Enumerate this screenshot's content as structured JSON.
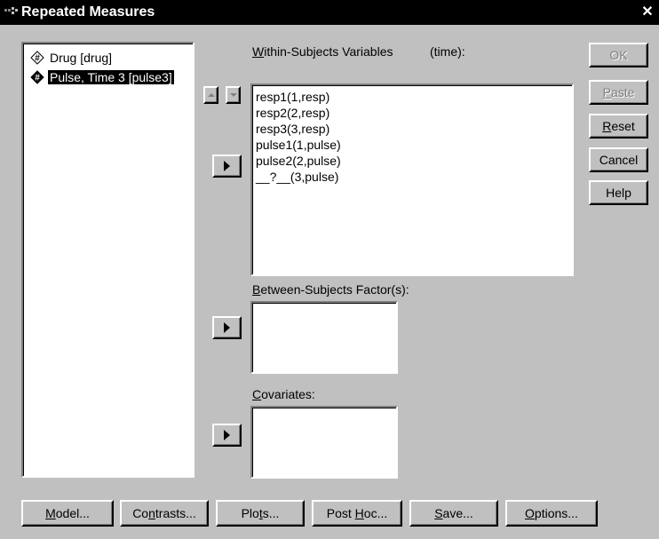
{
  "window": {
    "title": "Repeated Measures"
  },
  "source_list": [
    {
      "label": "Drug [drug]",
      "icon": "nominal-variable-icon",
      "selected": false
    },
    {
      "label": "Pulse, Time 3 [pulse3]",
      "icon": "scale-variable-icon",
      "selected": true
    }
  ],
  "within": {
    "label_mnemonic": "W",
    "label_rest": "ithin-Subjects Variables",
    "factor": "(time):",
    "items": [
      "resp1(1,resp)",
      "resp2(2,resp)",
      "resp3(3,resp)",
      "pulse1(1,pulse)",
      "pulse2(2,pulse)",
      "__?__(3,pulse)"
    ]
  },
  "between": {
    "label_mnemonic": "B",
    "label_rest": "etween-Subjects Factor(s):"
  },
  "covariates": {
    "label_mnemonic": "C",
    "label_rest": "ovariates:"
  },
  "side_buttons": {
    "ok": "OK",
    "paste_m": "P",
    "paste_r": "aste",
    "reset_m": "R",
    "reset_r": "eset",
    "cancel": "Cancel",
    "help": "Help"
  },
  "bottom_buttons": {
    "model_m": "M",
    "model_r": "odel...",
    "contrasts_a": "Co",
    "contrasts_m": "n",
    "contrasts_r": "trasts...",
    "plots_a": "Plo",
    "plots_m": "t",
    "plots_r": "s...",
    "posthoc_a": "Post ",
    "posthoc_m": "H",
    "posthoc_r": "oc...",
    "save_m": "S",
    "save_r": "ave...",
    "options_m": "O",
    "options_r": "ptions..."
  },
  "colors": {
    "face": "#c0c0c0",
    "title_bar": "#000000",
    "disabled_text": "#808080",
    "selection": "#000000"
  }
}
